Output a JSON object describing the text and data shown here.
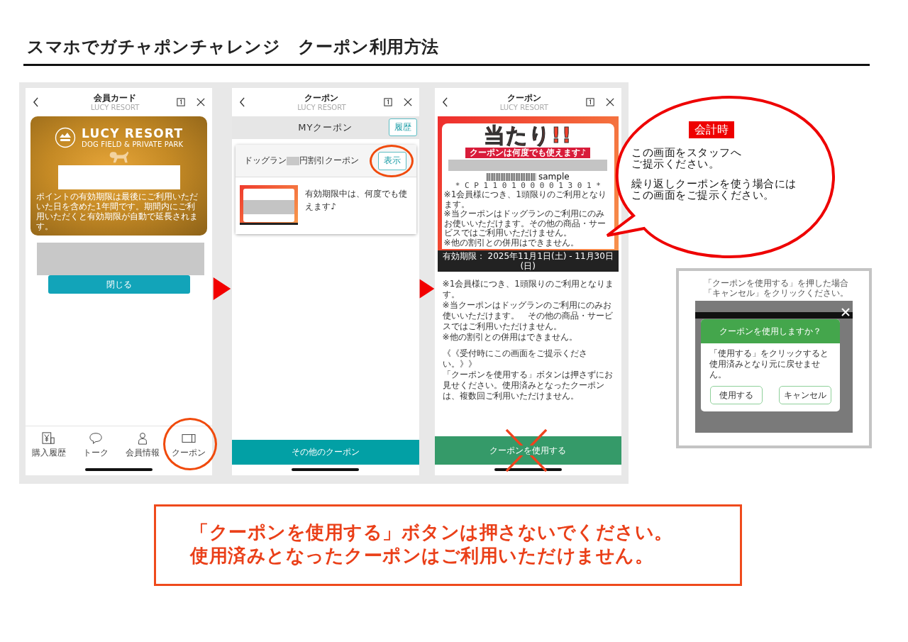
{
  "title": "スマホでガチャポンチャレンジ　クーポン利用方法",
  "member_card_screen": {
    "header": {
      "title": "会員カード",
      "subtitle": "LUCY RESORT"
    },
    "card": {
      "brand": "LUCY RESORT",
      "tagline": "DOG FIELD & PRIVATE PARK",
      "note": "ポイントの有効期限は最後にご利用いただいた日を含めた1年間です。期間内にご利用いただくと有効期限が自動で延長されます。"
    },
    "close_button": "閉じる",
    "tabs": [
      {
        "label": "購入履歴",
        "circled": false
      },
      {
        "label": "トーク",
        "circled": false
      },
      {
        "label": "会員情報",
        "circled": false
      },
      {
        "label": "クーポン",
        "circled": true
      }
    ]
  },
  "coupon_list_screen": {
    "header": {
      "title": "クーポン",
      "subtitle": "LUCY RESORT"
    },
    "section_title": "MYクーポン",
    "history_button": "履歴",
    "coupon": {
      "name_parts": [
        "ドッグラン",
        "円割引クーポン"
      ],
      "show_button": {
        "label": "表示",
        "circled": true
      },
      "description": "有効期限中は、何度でも使えます♪"
    },
    "footer_button": "その他のクーポン"
  },
  "coupon_detail_screen": {
    "header": {
      "title": "クーポン",
      "subtitle": "LUCY RESORT"
    },
    "coupon_image": {
      "headline": "当たり!!",
      "ribbon": "クーポンは何度でも使えます♪",
      "barcode_label": "sample",
      "barcode_number": "* C P 1 1 0 1 0 0 0 0 1 3 0 1 *",
      "notes": [
        "※1会員様につき、1頭限りのご利用となります。",
        "※当クーポンはドッグランのご利用にのみお使いいただけます。その他の商品・サービスではご利用いただけません。",
        "※他の割引との併用はできません。"
      ],
      "validity": "有効期限： 2025年11月1日(土) - 11月30日(日)"
    },
    "terms": [
      "※1会員様につき、1頭限りのご利用となります。",
      "※当クーポンはドッグランのご利用にのみお使いいただけます。　その他の商品・サービスではご利用いただけません。",
      "※他の割引との併用はできません。"
    ],
    "notice": [
      "《《受付時にこの画面をご提示ください。》》",
      "「クーポンを使用する」ボタンは押さずにお見せください。使用済みとなったクーポンは、複数回ご利用いただけません。"
    ],
    "use_button": {
      "label": "クーポンを使用する",
      "crossed": true
    }
  },
  "speech_bubble": {
    "badge": "会計時",
    "paragraphs": [
      [
        "この画面をスタッフへ",
        "ご提示ください。"
      ],
      [
        "繰り返しクーポンを使う場合には",
        "この画面をご提示ください。"
      ]
    ]
  },
  "dialog_example": {
    "caption": [
      "「クーポンを使用する」を押した場合",
      "「キャンセル」をクリックください。"
    ],
    "dialog": {
      "title": "クーポンを使用しますか？",
      "message": "「使用する」をクリックすると使用済みとなり元に戻せません。",
      "buttons": [
        "使用する",
        "キャンセル"
      ]
    }
  },
  "warning": [
    "「クーポンを使用する」ボタンは押さないでください。",
    "使用済みとなったクーポンはご利用いただけません。"
  ]
}
